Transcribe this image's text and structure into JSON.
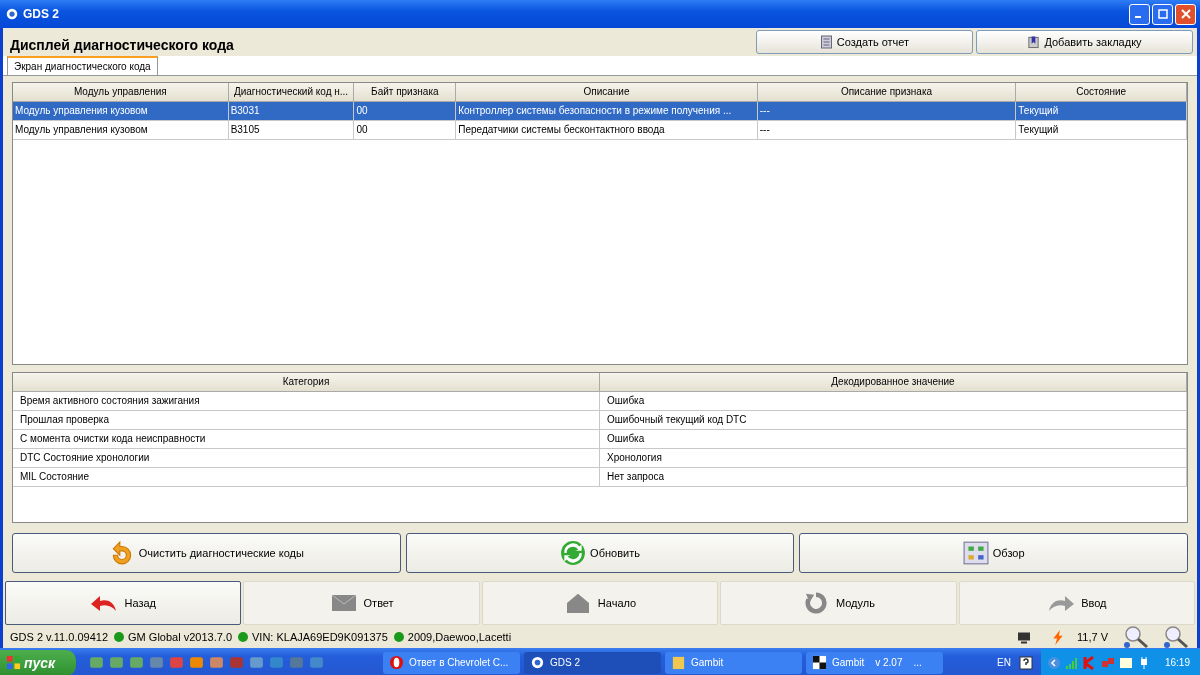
{
  "window": {
    "title": "GDS 2"
  },
  "header": {
    "title": "Дисплей диагностического кода",
    "buttons": [
      {
        "label": "Создать отчет",
        "kind": "report"
      },
      {
        "label": "Добавить закладку",
        "kind": "bookmark"
      }
    ]
  },
  "tabs": [
    {
      "label": "Экран диагностического кода",
      "selected": true
    }
  ],
  "dtc_table": {
    "columns": [
      "Модуль управления",
      "Диагностический код н...",
      "Байт признака",
      "Описание",
      "Описание признака",
      "Состояние"
    ],
    "rows": [
      {
        "cells": [
          "Модуль управления кузовом",
          "B3031",
          "00",
          "Контроллер системы безопасности в режиме получения ...",
          "---",
          "Текущий"
        ],
        "selected": true
      },
      {
        "cells": [
          "Модуль управления кузовом",
          "B3105",
          "00",
          "Передатчики системы бесконтактного ввода",
          "---",
          "Текущий"
        ],
        "selected": false
      }
    ]
  },
  "detail_table": {
    "columns": [
      "Категория",
      "Декодированное значение"
    ],
    "rows": [
      [
        "Время активного состояния зажигания",
        "Ошибка"
      ],
      [
        "Прошлая проверка",
        "Ошибочный текущий код DTC"
      ],
      [
        "С момента очистки кода неисправности",
        "Ошибка"
      ],
      [
        "DTC Состояние хронологии",
        "Хронология"
      ],
      [
        "MIL Состояние",
        "Нет запроса"
      ]
    ]
  },
  "actions": [
    {
      "label": "Очистить диагностические коды",
      "kind": "clear"
    },
    {
      "label": "Обновить",
      "kind": "refresh"
    },
    {
      "label": "Обзор",
      "kind": "overview"
    }
  ],
  "nav": [
    {
      "label": "Назад",
      "kind": "back",
      "disabled": false
    },
    {
      "label": "Ответ",
      "kind": "reply",
      "disabled": true
    },
    {
      "label": "Начало",
      "kind": "home",
      "disabled": true
    },
    {
      "label": "Модуль",
      "kind": "module",
      "disabled": true
    },
    {
      "label": "Ввод",
      "kind": "enter",
      "disabled": true
    }
  ],
  "status_bar": {
    "items": [
      {
        "text": "GDS 2 v.11.0.09412"
      },
      {
        "text": "GM Global v2013.7.0",
        "color": "#1a9a1a"
      },
      {
        "text": "VIN: KLAJA69ED9K091375",
        "color": "#1a9a1a"
      },
      {
        "text": "2009,Daewoo,Lacetti",
        "color": "#1a9a1a"
      }
    ],
    "voltage": "11,7 V"
  },
  "taskbar": {
    "start": "пуск",
    "tasks": [
      {
        "texts": [
          "Ответ в Chevrolet C..."
        ],
        "kind": "opera",
        "selected": false
      },
      {
        "texts": [
          "GDS 2"
        ],
        "kind": "gds",
        "selected": true
      },
      {
        "texts": [
          "Gambit"
        ],
        "kind": "folder",
        "selected": false
      },
      {
        "texts": [
          "Gambit",
          "v 2.07",
          "..."
        ],
        "kind": "gambit",
        "selected": false
      }
    ],
    "language": "EN",
    "clock": "16:19"
  }
}
